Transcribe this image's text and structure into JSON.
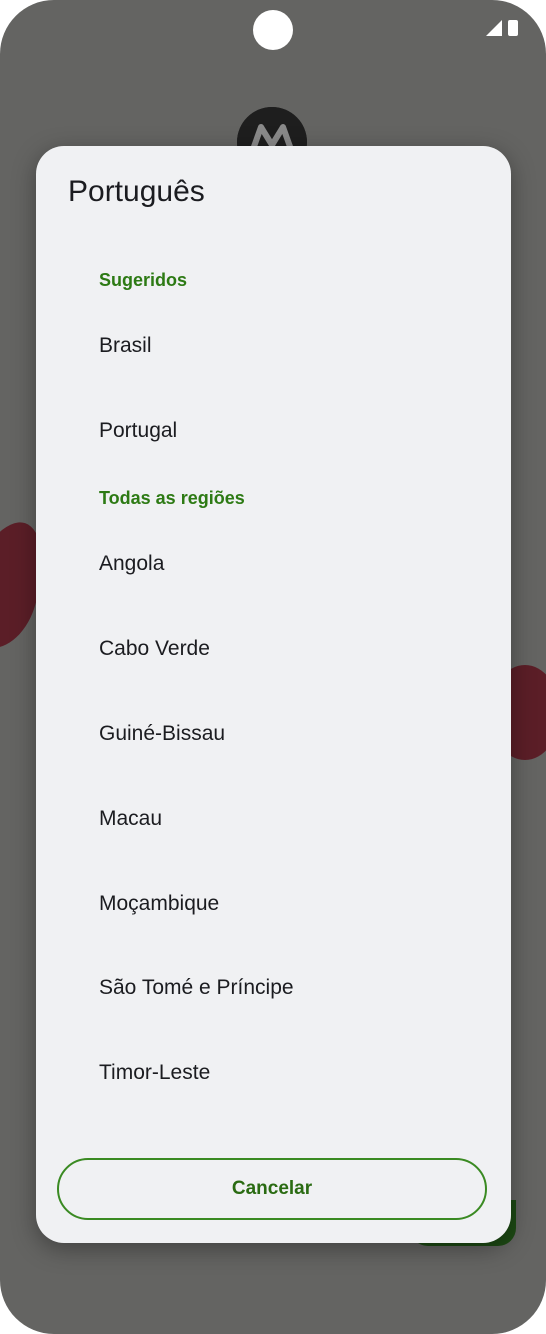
{
  "dialog": {
    "title": "Português",
    "sections": [
      {
        "header": "Sugeridos",
        "items": [
          "Brasil",
          "Portugal"
        ]
      },
      {
        "header": "Todas as regiões",
        "items": [
          "Angola",
          "Cabo Verde",
          "Guiné-Bissau",
          "Macau",
          "Moçambique",
          "São Tomé e Príncipe",
          "Timor-Leste"
        ]
      }
    ],
    "cancel_label": "Cancelar"
  },
  "colors": {
    "scrim": "#646462",
    "dialog_bg": "#f0f1f3",
    "accent_green": "#2d7a14",
    "text": "#1b1c20"
  },
  "icons": {
    "status": [
      "signal-icon",
      "battery-icon"
    ],
    "background": "motorola-logo-icon"
  }
}
